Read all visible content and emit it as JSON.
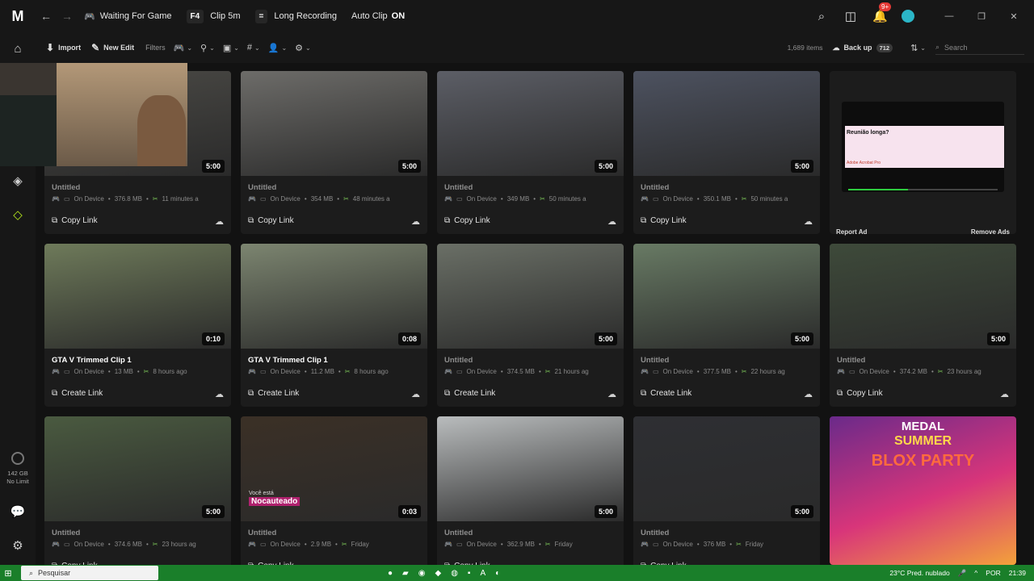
{
  "titlebar": {
    "waiting": "Waiting For Game",
    "clip_key": "F4",
    "clip_label": "Clip 5m",
    "rec_key": "=",
    "rec_label": "Long Recording",
    "autoclip_label": "Auto Clip",
    "autoclip_state": "ON",
    "notif_badge": "9+"
  },
  "toolbar": {
    "import": "Import",
    "new_edit": "New Edit",
    "filters": "Filters",
    "items": "1,689 items",
    "backup": "Back up",
    "backup_count": "712",
    "search_placeholder": "Search"
  },
  "sidebar": {
    "storage_size": "142 GB",
    "storage_limit": "No Limit"
  },
  "cards": [
    {
      "title": "Untitled",
      "device": "On Device",
      "size": "376.8 MB",
      "time": "11 minutes a",
      "duration": "5:00",
      "action": "Copy Link",
      "thumb": "#4b4a46",
      "highlight": false
    },
    {
      "title": "Untitled",
      "device": "On Device",
      "size": "354 MB",
      "time": "48 minutes a",
      "duration": "5:00",
      "action": "Copy Link",
      "thumb": "#6d6c69",
      "highlight": false
    },
    {
      "title": "Untitled",
      "device": "On Device",
      "size": "349 MB",
      "time": "50 minutes a",
      "duration": "5:00",
      "action": "Copy Link",
      "thumb": "#5c5e66",
      "highlight": false
    },
    {
      "title": "Untitled",
      "device": "On Device",
      "size": "350.1 MB",
      "time": "50 minutes a",
      "duration": "5:00",
      "action": "Copy Link",
      "thumb": "#4d5260",
      "highlight": false
    },
    {
      "title": "GTA V Trimmed Clip 1",
      "device": "On Device",
      "size": "13 MB",
      "time": "8 hours ago",
      "duration": "0:10",
      "action": "Create Link",
      "thumb": "#6e7a5a",
      "highlight": true
    },
    {
      "title": "GTA V Trimmed Clip 1",
      "device": "On Device",
      "size": "11.2 MB",
      "time": "8 hours ago",
      "duration": "0:08",
      "action": "Create Link",
      "thumb": "#7c8570",
      "highlight": true
    },
    {
      "title": "Untitled",
      "device": "On Device",
      "size": "374.5 MB",
      "time": "21 hours ag",
      "duration": "5:00",
      "action": "Create Link",
      "thumb": "#6a6f66",
      "highlight": false
    },
    {
      "title": "Untitled",
      "device": "On Device",
      "size": "377.5 MB",
      "time": "22 hours ag",
      "duration": "5:00",
      "action": "Create Link",
      "thumb": "#687a64",
      "highlight": false
    },
    {
      "title": "Untitled",
      "device": "On Device",
      "size": "374.2 MB",
      "time": "23 hours ag",
      "duration": "5:00",
      "action": "Copy Link",
      "thumb": "#3e4a3a",
      "highlight": false
    },
    {
      "title": "Untitled",
      "device": "On Device",
      "size": "374.6 MB",
      "time": "23 hours ag",
      "duration": "5:00",
      "action": "Copy Link",
      "thumb": "#4a5a40",
      "highlight": false
    },
    {
      "title": "Untitled",
      "device": "On Device",
      "size": "2.9 MB",
      "time": "Friday",
      "duration": "0:03",
      "action": "Copy Link",
      "thumb": "#3b3026",
      "highlight": false
    },
    {
      "title": "Untitled",
      "device": "On Device",
      "size": "362.9 MB",
      "time": "Friday",
      "duration": "5:00",
      "action": "Copy Link",
      "thumb": "#b9bcbd",
      "highlight": false
    },
    {
      "title": "Untitled",
      "device": "On Device",
      "size": "376 MB",
      "time": "Friday",
      "duration": "5:00",
      "action": "Copy Link",
      "thumb": "#2e2f33",
      "highlight": false
    }
  ],
  "ad": {
    "headline": "Reunião longa?",
    "brand": "Adobe Acrobat Pro",
    "report": "Report Ad",
    "remove": "Remove Ads"
  },
  "promo": {
    "line1": "MEDAL",
    "line2": "SUMMER",
    "line3": "BLOX PARTY"
  },
  "thumb_overlay": {
    "nocauteado_small": "Você está",
    "nocauteado": "Nocauteado"
  },
  "taskbar": {
    "search": "Pesquisar",
    "weather": "23°C  Pred. nublado",
    "lang": "POR",
    "time": "21:39"
  }
}
